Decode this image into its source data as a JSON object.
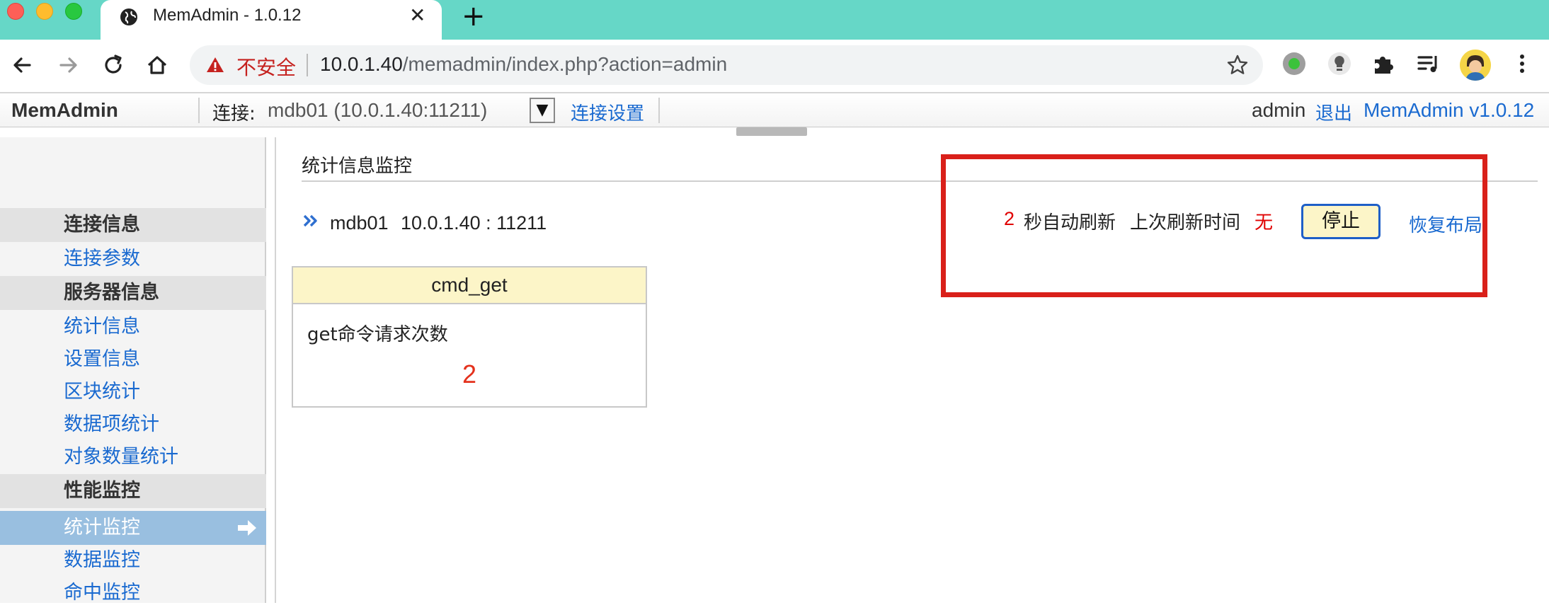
{
  "browser": {
    "tab_title": "MemAdmin - 1.0.12",
    "new_tab_label": "+",
    "address_security": "不安全",
    "url_host": "10.0.1.40",
    "url_path": "/memadmin/index.php?action=admin"
  },
  "header": {
    "brand": "MemAdmin",
    "connection_label": "连接:",
    "connection_value": "mdb01 (10.0.1.40:11211)",
    "dropdown_glyph": "▼",
    "connection_settings": "连接设置",
    "user": "admin",
    "logout": "退出",
    "version": "MemAdmin v1.0.12"
  },
  "sidebar": {
    "items": [
      {
        "label": "连接信息",
        "type": "section"
      },
      {
        "label": "连接参数",
        "type": "link"
      },
      {
        "label": "服务器信息",
        "type": "section"
      },
      {
        "label": "统计信息",
        "type": "link"
      },
      {
        "label": "设置信息",
        "type": "link"
      },
      {
        "label": "区块统计",
        "type": "link"
      },
      {
        "label": "数据项统计",
        "type": "link"
      },
      {
        "label": "对象数量统计",
        "type": "link"
      },
      {
        "label": "性能监控",
        "type": "section"
      },
      {
        "label": "统计监控",
        "type": "active"
      },
      {
        "label": "数据监控",
        "type": "link"
      },
      {
        "label": "命中监控",
        "type": "link"
      }
    ]
  },
  "main": {
    "panel_title": "统计信息监控",
    "server_name": "mdb01",
    "server_address": "10.0.1.40 : 11211",
    "stat_card": {
      "title": "cmd_get",
      "description": "get命令请求次数",
      "value": "2"
    },
    "refresh": {
      "interval": "2",
      "interval_label": "秒自动刷新",
      "last_label": "上次刷新时间",
      "last_value": "无",
      "stop_button": "停止",
      "reset_layout": "恢复布局"
    }
  },
  "colors": {
    "tabbar": "#66d7c7",
    "link": "#1a6ad0",
    "alert_red": "#e00000",
    "highlight_border": "#d9201a",
    "active_item": "#99bfe0",
    "card_header": "#fcf5c8"
  }
}
